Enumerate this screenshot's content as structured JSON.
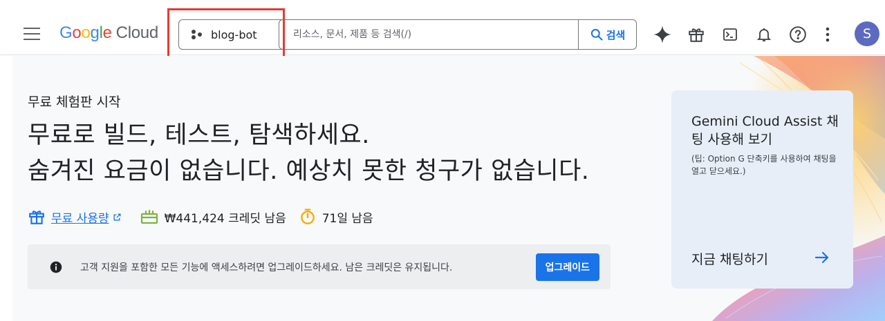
{
  "brand": {
    "google_letters": [
      "G",
      "o",
      "o",
      "g",
      "l",
      "e"
    ],
    "product": "Cloud"
  },
  "project_picker": {
    "name": "blog-bot"
  },
  "search": {
    "placeholder": "리소스, 문서, 제품 등 검색(/)",
    "button_label": "검색"
  },
  "toolbar_icons": [
    "gemini-sparkle-icon",
    "gift-icon",
    "terminal-icon",
    "notifications-bell-icon",
    "help-icon",
    "more-vert-icon"
  ],
  "account": {
    "avatar_letter": "S"
  },
  "trial": {
    "label": "무료 체험판 시작",
    "headline_line1": "무료로 빌드, 테스트, 탐색하세요.",
    "headline_line2": "숨겨진 요금이 없습니다. 예상치 못한 청구가 없습니다."
  },
  "stats": {
    "free_usage_link": "무료 사용량",
    "credit_text": "₩441,424 크레딧 남음",
    "days_text": "71일 남음"
  },
  "notice": {
    "message": "고객 지원을 포함한 모든 기능에 액세스하려면 업그레이드하세요. 남은 크레딧은 유지됩니다.",
    "upgrade_label": "업그레이드"
  },
  "gemini_card": {
    "title": "Gemini Cloud Assist 채팅 사용해 보기",
    "tip": "(팁: Option G 단축키를 사용하여 채팅을 열고 닫으세요.)",
    "cta": "지금 채팅하기"
  },
  "colors": {
    "accent": "#1a73e8",
    "highlight": "#e53935",
    "avatar": "#5c6bc0",
    "card_bg": "#e8eef8"
  }
}
